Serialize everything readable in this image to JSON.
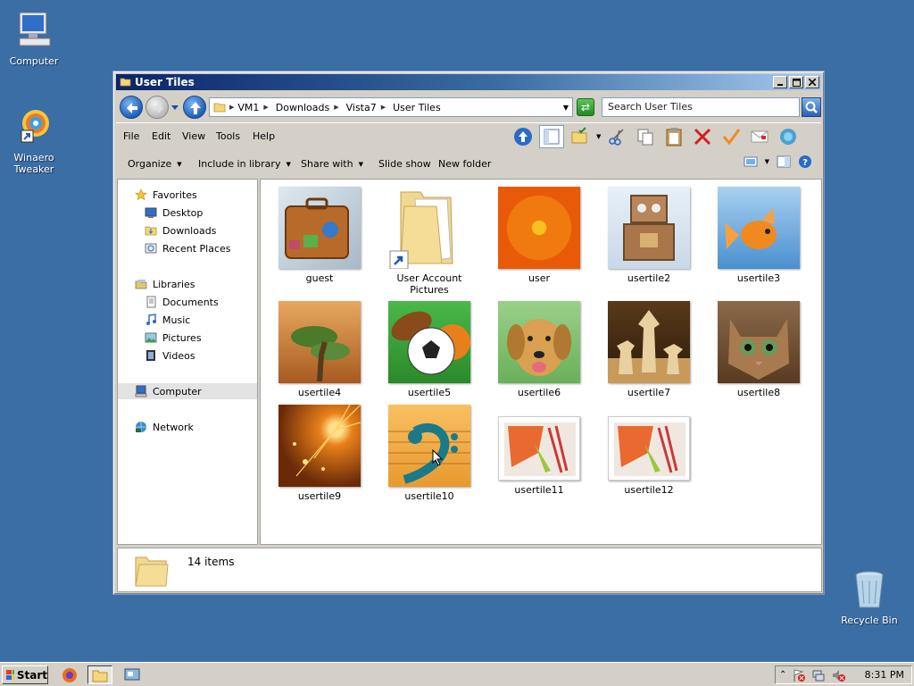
{
  "desktop": {
    "icons": [
      {
        "label": "Computer"
      },
      {
        "label": "Winaero Tweaker"
      },
      {
        "label": "Recycle Bin"
      }
    ]
  },
  "window": {
    "title": "User Tiles",
    "breadcrumb": [
      "VM1",
      "Downloads",
      "Vista7",
      "User Tiles"
    ],
    "search_placeholder": "Search User Tiles",
    "menu": [
      "File",
      "Edit",
      "View",
      "Tools",
      "Help"
    ],
    "commands": [
      {
        "label": "Organize",
        "dropdown": true
      },
      {
        "label": "Include in library",
        "dropdown": true
      },
      {
        "label": "Share with",
        "dropdown": true
      },
      {
        "label": "Slide show",
        "dropdown": false
      },
      {
        "label": "New folder",
        "dropdown": false
      }
    ],
    "nav": {
      "favorites": "Favorites",
      "favorites_items": [
        "Desktop",
        "Downloads",
        "Recent Places"
      ],
      "libraries": "Libraries",
      "libraries_items": [
        "Documents",
        "Music",
        "Pictures",
        "Videos"
      ],
      "computer": "Computer",
      "network": "Network"
    },
    "files": [
      {
        "name": "guest",
        "icon": "suitcase-icon"
      },
      {
        "name": "User Account Pictures",
        "icon": "folder-shortcut-icon"
      },
      {
        "name": "user",
        "icon": "orange-flower-icon"
      },
      {
        "name": "usertile2",
        "icon": "robot-toy-icon"
      },
      {
        "name": "usertile3",
        "icon": "goldfish-icon"
      },
      {
        "name": "usertile4",
        "icon": "bonsai-icon"
      },
      {
        "name": "usertile5",
        "icon": "sports-balls-icon"
      },
      {
        "name": "usertile6",
        "icon": "puppy-icon"
      },
      {
        "name": "usertile7",
        "icon": "chess-icon"
      },
      {
        "name": "usertile8",
        "icon": "kitten-icon"
      },
      {
        "name": "usertile9",
        "icon": "sparkles-icon"
      },
      {
        "name": "usertile10",
        "icon": "bass-clef-icon"
      },
      {
        "name": "usertile11",
        "icon": "paintbrush-icon"
      },
      {
        "name": "usertile12",
        "icon": "paintbrush-icon"
      }
    ],
    "status": "14 items"
  },
  "taskbar": {
    "start_label": "Start",
    "clock": "8:31 PM"
  },
  "colors": {
    "desktop": "#3a6ea5",
    "titlebar_start": "#0a246a",
    "chrome": "#d4d0c8"
  }
}
